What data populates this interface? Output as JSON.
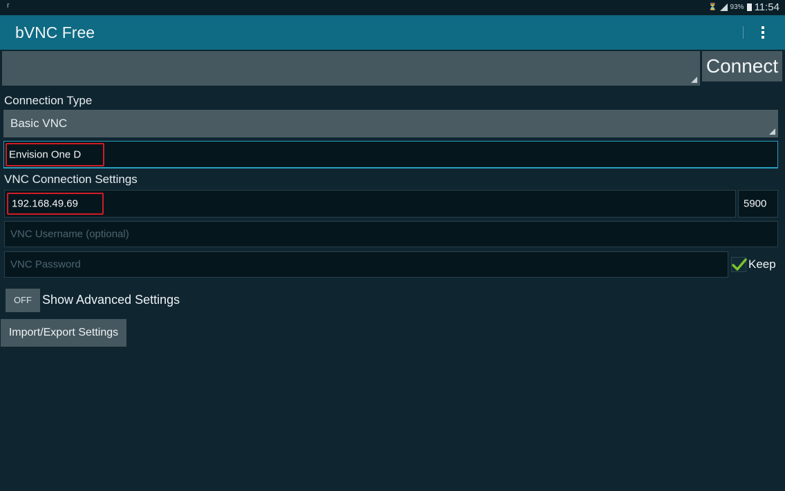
{
  "status_bar": {
    "left_icon": "r",
    "battery": "93%",
    "time": "11:54"
  },
  "action_bar": {
    "title": "bVNC Free"
  },
  "connect_button": "Connect",
  "connection_type": {
    "label": "Connection Type",
    "selected": "Basic VNC"
  },
  "nickname_value": "Envision One D",
  "vnc_settings": {
    "label": "VNC Connection Settings",
    "host_value": "192.168.49.69",
    "port_value": "5900",
    "username_placeholder": "VNC Username (optional)",
    "password_placeholder": "VNC Password",
    "keep_label": "Keep"
  },
  "advanced": {
    "toggle_state": "OFF",
    "label": "Show Advanced Settings"
  },
  "import_export_button": "Import/Export Settings",
  "colors": {
    "background": "#0f2530",
    "action_bar": "#0f6a83",
    "highlight": "#d21c25",
    "check": "#7cc22c"
  }
}
